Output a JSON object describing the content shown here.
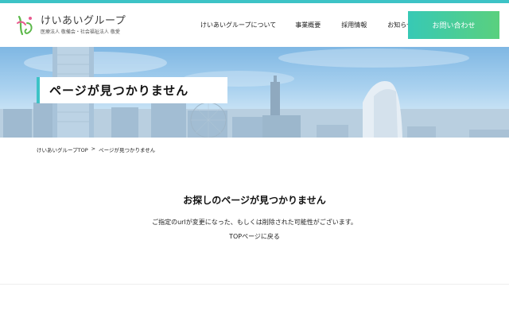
{
  "header": {
    "logo_name": "けいあいグループ",
    "logo_sub": "医療法人 敬備会・社会福祉法人 敬愛",
    "nav": [
      {
        "label": "けいあいグループについて"
      },
      {
        "label": "事業概要"
      },
      {
        "label": "採用情報"
      },
      {
        "label": "お知らせ"
      }
    ],
    "cta_label": "お問い合わせ"
  },
  "hero": {
    "title": "ページが見つかりません"
  },
  "breadcrumb": {
    "home": "けいあいグループTOP",
    "separator": ">",
    "current": "ページが見つかりません"
  },
  "main": {
    "heading": "お探しのページが見つかりません",
    "message": "ご指定のurlが変更になった、もしくは削除された可能性がございます。",
    "link": "TOPページに戻る"
  },
  "colors": {
    "accent": "#3dc3c6",
    "cta_start": "#37c9b5",
    "cta_end": "#5ad07e"
  }
}
